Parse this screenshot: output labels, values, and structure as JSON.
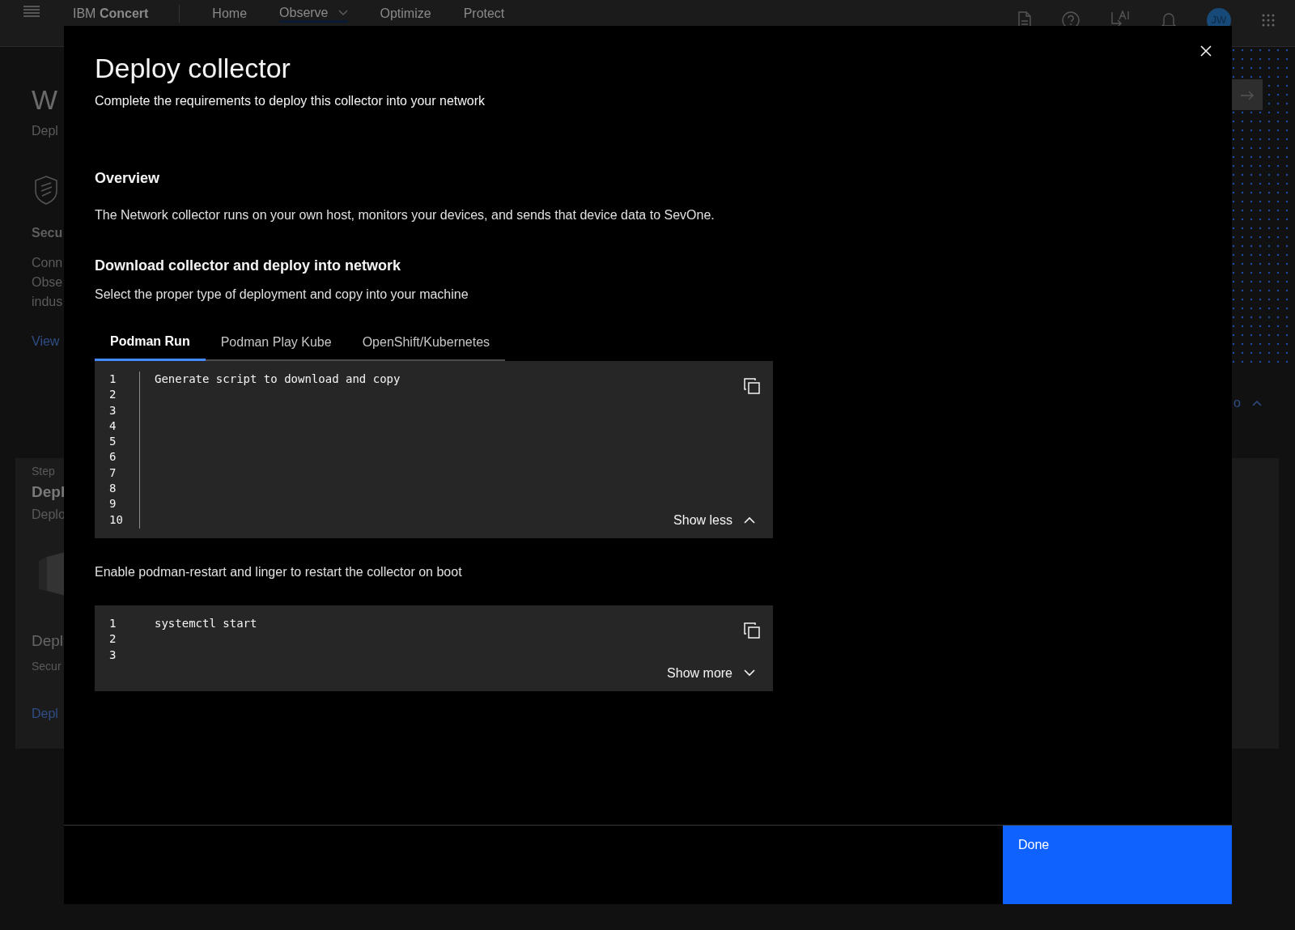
{
  "header": {
    "brand_prefix": "IBM",
    "brand_name": "Concert",
    "avatar_initials": "JW",
    "nav": [
      {
        "label": "Home",
        "kind": "link",
        "selected": false
      },
      {
        "label": "Observe",
        "kind": "dropdown",
        "selected": true
      },
      {
        "label": "Optimize",
        "kind": "link",
        "selected": false
      },
      {
        "label": "Protect",
        "kind": "link",
        "selected": false
      }
    ]
  },
  "background_left": [
    {
      "text": "W",
      "kind": "title"
    },
    {
      "text": "Depl",
      "kind": "body"
    },
    {
      "kind": "shield"
    },
    {
      "text": "Secu",
      "kind": "heading"
    },
    {
      "text": "Conn",
      "kind": "body"
    },
    {
      "text": "Obse",
      "kind": "body"
    },
    {
      "text": "indus",
      "kind": "body"
    },
    {
      "text": "View",
      "kind": "link"
    },
    {
      "text": "Step",
      "kind": "small"
    },
    {
      "text": "Depl",
      "kind": "card-title"
    },
    {
      "text": "Deplo",
      "kind": "body"
    },
    {
      "kind": "box"
    },
    {
      "text": "Depl",
      "kind": "subtitle"
    },
    {
      "text": "Secur",
      "kind": "small"
    },
    {
      "text": "Depl",
      "kind": "link"
    }
  ],
  "background_right": {
    "link": "o"
  },
  "modal": {
    "title": "Deploy collector",
    "subtitle": "Complete the requirements to deploy this collector into your network",
    "sections": [
      {
        "heading": "Overview",
        "text": "The Network collector runs on your own host, monitors your devices, and sends that device data to SevOne."
      },
      {
        "heading": "Download collector and deploy into network",
        "text": "Select the proper type of deployment and copy into your machine"
      }
    ],
    "tabs": [
      {
        "label": "Podman Run",
        "selected": true
      },
      {
        "label": "Podman Play Kube",
        "selected": false
      },
      {
        "label": "OpenShift/Kubernetes",
        "selected": false
      }
    ],
    "code_blocks": [
      {
        "line_numbers": [
          "1",
          "2",
          "3",
          "4",
          "5",
          "6",
          "7",
          "8",
          "9",
          "10"
        ],
        "code": "Generate script to download and copy",
        "expanded": true,
        "toggle": "Show less"
      },
      {
        "intro": "Enable podman-restart and linger to restart the collector on boot",
        "line_numbers": [
          "1",
          "2",
          "3"
        ],
        "code": "systemctl start",
        "expanded": false,
        "toggle": "Show more"
      }
    ],
    "primary_button": "Done"
  }
}
